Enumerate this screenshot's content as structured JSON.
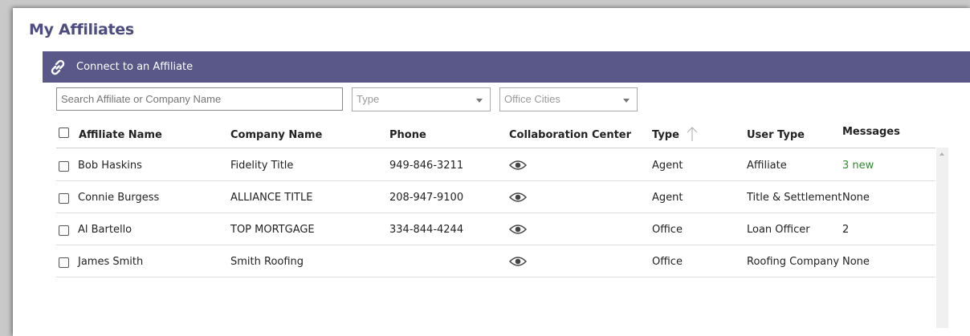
{
  "page": {
    "title": "My Affiliates"
  },
  "banner": {
    "label": "Connect to an Affiliate",
    "icon": "link-icon",
    "color": "#5a5888"
  },
  "filters": {
    "search_placeholder": "Search Affiliate or Company Name",
    "type_placeholder": "Type",
    "cities_placeholder": "Office Cities"
  },
  "table": {
    "columns": [
      "Affiliate Name",
      "Company Name",
      "Phone",
      "Collaboration Center",
      "Type",
      "User Type",
      "Messages"
    ],
    "sort": {
      "column": "Type",
      "direction": "ascending"
    },
    "rows": [
      {
        "name": "Bob Haskins",
        "company": "Fidelity Title",
        "phone": "949-846-3211",
        "collab_icon": "eye-icon",
        "type": "Agent",
        "user_type": "Affiliate",
        "messages": "3 new",
        "messages_color": "#2e8b2e"
      },
      {
        "name": "Connie Burgess",
        "company": "ALLIANCE TITLE",
        "phone": "208-947-9100",
        "collab_icon": "eye-icon",
        "type": "Agent",
        "user_type": "Title & Settlement",
        "messages": "None"
      },
      {
        "name": "Al Bartello",
        "company": "TOP MORTGAGE",
        "phone": "334-844-4244",
        "collab_icon": "eye-icon",
        "type": "Office",
        "user_type": "Loan Officer",
        "messages": "2"
      },
      {
        "name": "James Smith",
        "company": "Smith Roofing",
        "phone": "",
        "collab_icon": "eye-icon",
        "type": "Office",
        "user_type": "Roofing Company",
        "messages": "None"
      }
    ]
  }
}
